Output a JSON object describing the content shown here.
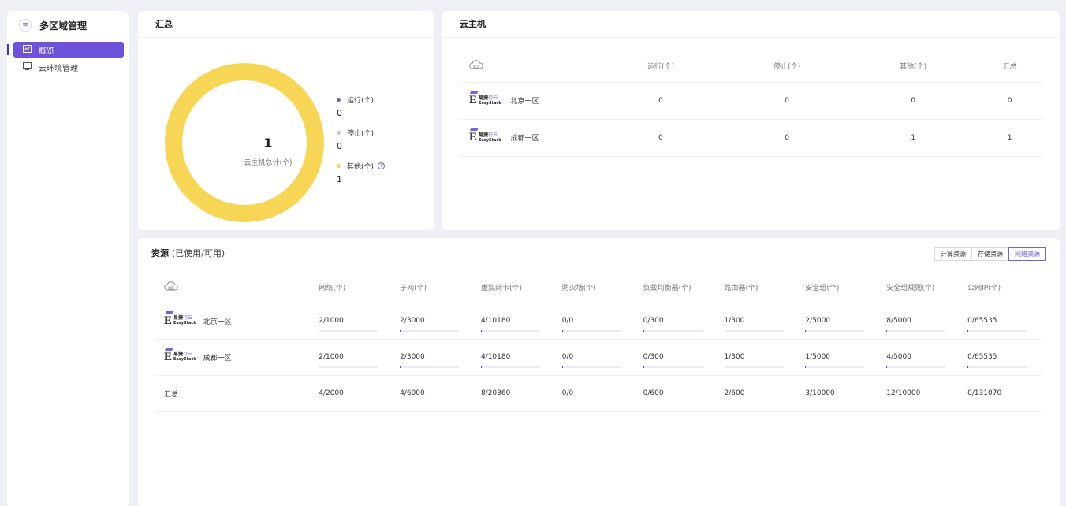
{
  "sidebar": {
    "title": "多区域管理",
    "items": [
      {
        "label": "概览",
        "icon": "chart-icon",
        "active": true
      },
      {
        "label": "云环境管理",
        "icon": "monitor-icon",
        "active": false
      }
    ]
  },
  "summary": {
    "title": "汇总",
    "total": "1",
    "total_label": "云主机总计(个)",
    "legend": [
      {
        "label": "运行(个)",
        "value": "0",
        "color": "#5b5fd0"
      },
      {
        "label": "停止(个)",
        "value": "0",
        "color": "#c8c8c8"
      },
      {
        "label": "其他(个)",
        "value": "1",
        "color": "#f7d655"
      }
    ],
    "donut_color": "#f7d655"
  },
  "vm": {
    "title": "云主机",
    "headers": [
      "运行(个)",
      "停止(个)",
      "其他(个)",
      "汇总"
    ],
    "rows": [
      {
        "region": "北京一区",
        "values": [
          "0",
          "0",
          "0",
          "0"
        ]
      },
      {
        "region": "成都一区",
        "values": [
          "0",
          "0",
          "1",
          "1"
        ]
      }
    ]
  },
  "logo": {
    "cn_main": "易捷",
    "cn_hl": "行云",
    "en": "EasyStack"
  },
  "resources": {
    "title": "资源",
    "subtitle": "(已使用/可用)",
    "tabs": [
      "计算资源",
      "存储资源",
      "网络资源"
    ],
    "active_tab": 2,
    "headers": [
      "网络(个)",
      "子网(个)",
      "虚拟网卡(个)",
      "防火墙(个)",
      "负载均衡器(个)",
      "路由器(个)",
      "安全组(个)",
      "安全组规则(个)",
      "公网IP(个)"
    ],
    "rows": [
      {
        "region": "北京一区",
        "values": [
          "2/1000",
          "2/3000",
          "4/10180",
          "0/0",
          "0/300",
          "1/300",
          "2/5000",
          "8/5000",
          "0/65535"
        ],
        "ratios": [
          0.002,
          0.0007,
          0.0004,
          0,
          0,
          0.0033,
          0.0004,
          0.0016,
          0
        ]
      },
      {
        "region": "成都一区",
        "values": [
          "2/1000",
          "2/3000",
          "4/10180",
          "0/0",
          "0/300",
          "1/300",
          "1/5000",
          "4/5000",
          "0/65535"
        ],
        "ratios": [
          0.002,
          0.0007,
          0.0004,
          0,
          0,
          0.0033,
          0.0002,
          0.0008,
          0
        ]
      }
    ],
    "total_row": {
      "label": "汇总",
      "values": [
        "4/2000",
        "4/6000",
        "8/20360",
        "0/0",
        "0/600",
        "2/600",
        "3/10000",
        "12/10000",
        "0/131070"
      ]
    }
  },
  "colors": {
    "accent": "#6e52d9",
    "bar_track": "#e8eaf6",
    "bar_fill": "#5b46cf"
  }
}
